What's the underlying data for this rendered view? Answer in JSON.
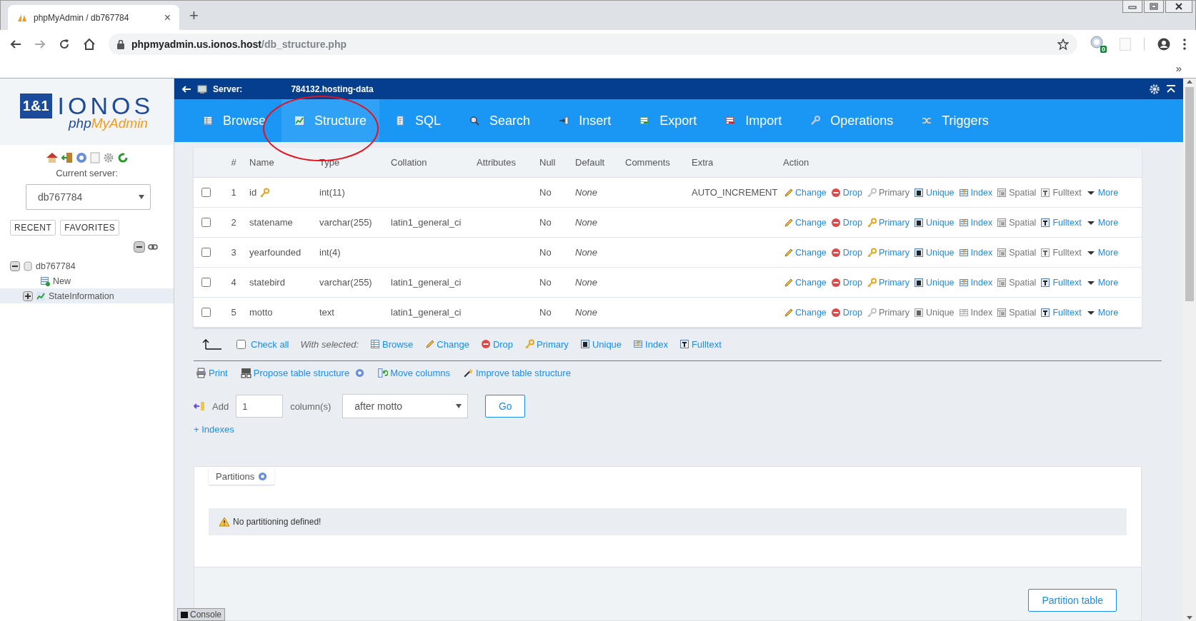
{
  "browser": {
    "tab": {
      "title": "phpMyAdmin / db767784",
      "close": "×"
    },
    "new_tab": "+",
    "url": {
      "host": "phpmyadmin.us.ionos.host",
      "path": "/db_structure.php"
    },
    "extension_badge": "0",
    "bookmarks_overflow": "»"
  },
  "sidebar": {
    "logo": {
      "mark": "1&1",
      "brand": "IONOS",
      "product_prefix": "php",
      "product_name": "MyAdmin"
    },
    "current_server_label": "Current server:",
    "server_select": "db767784",
    "buttons": [
      "RECENT",
      "FAVORITES"
    ],
    "tree": [
      {
        "label": "db767784",
        "kind": "database",
        "expanded": true,
        "selected": false,
        "children": [
          {
            "label": "New",
            "kind": "new",
            "selected": false
          },
          {
            "label": "StateInformation",
            "kind": "table",
            "expanded": false,
            "selected": true
          }
        ]
      }
    ]
  },
  "server_bar": {
    "label": "Server:",
    "value": "784132.hosting-data"
  },
  "menu": [
    {
      "label": "Browse",
      "kind": "browse",
      "selected": false
    },
    {
      "label": "Structure",
      "kind": "structure",
      "selected": true
    },
    {
      "label": "SQL",
      "kind": "sql",
      "selected": false
    },
    {
      "label": "Search",
      "kind": "search",
      "selected": false
    },
    {
      "label": "Insert",
      "kind": "insert",
      "selected": false
    },
    {
      "label": "Export",
      "kind": "export",
      "selected": false
    },
    {
      "label": "Import",
      "kind": "import",
      "selected": false
    },
    {
      "label": "Operations",
      "kind": "operations",
      "selected": false
    },
    {
      "label": "Triggers",
      "kind": "triggers",
      "selected": false
    }
  ],
  "table": {
    "columns": [
      "#",
      "Name",
      "Type",
      "Collation",
      "Attributes",
      "Null",
      "Default",
      "Comments",
      "Extra",
      "Action"
    ],
    "rows": [
      {
        "checked": false,
        "num": "1",
        "name": "id",
        "primary_key": true,
        "type": "int(11)",
        "collation": "",
        "null": "No",
        "default": "None",
        "extra": "AUTO_INCREMENT",
        "actions": [
          {
            "kind": "change",
            "label": "Change",
            "disabled": false
          },
          {
            "kind": "drop",
            "label": "Drop",
            "disabled": false
          },
          {
            "kind": "primary",
            "label": "Primary",
            "disabled": true
          },
          {
            "kind": "unique",
            "label": "Unique",
            "disabled": false
          },
          {
            "kind": "index",
            "label": "Index",
            "disabled": false
          },
          {
            "kind": "spatial",
            "label": "Spatial",
            "disabled": true
          },
          {
            "kind": "fulltext",
            "label": "Fulltext",
            "disabled": true
          },
          {
            "kind": "more",
            "label": "More",
            "disabled": false
          }
        ]
      },
      {
        "checked": false,
        "num": "2",
        "name": "statename",
        "primary_key": false,
        "type": "varchar(255)",
        "collation": "latin1_general_ci",
        "null": "No",
        "default": "None",
        "extra": "",
        "actions": [
          {
            "kind": "change",
            "label": "Change",
            "disabled": false
          },
          {
            "kind": "drop",
            "label": "Drop",
            "disabled": false
          },
          {
            "kind": "primary",
            "label": "Primary",
            "disabled": false
          },
          {
            "kind": "unique",
            "label": "Unique",
            "disabled": false
          },
          {
            "kind": "index",
            "label": "Index",
            "disabled": false
          },
          {
            "kind": "spatial",
            "label": "Spatial",
            "disabled": true
          },
          {
            "kind": "fulltext",
            "label": "Fulltext",
            "disabled": false
          },
          {
            "kind": "more",
            "label": "More",
            "disabled": false
          }
        ]
      },
      {
        "checked": false,
        "num": "3",
        "name": "yearfounded",
        "primary_key": false,
        "type": "int(4)",
        "collation": "",
        "null": "No",
        "default": "None",
        "extra": "",
        "actions": [
          {
            "kind": "change",
            "label": "Change",
            "disabled": false
          },
          {
            "kind": "drop",
            "label": "Drop",
            "disabled": false
          },
          {
            "kind": "primary",
            "label": "Primary",
            "disabled": false
          },
          {
            "kind": "unique",
            "label": "Unique",
            "disabled": false
          },
          {
            "kind": "index",
            "label": "Index",
            "disabled": false
          },
          {
            "kind": "spatial",
            "label": "Spatial",
            "disabled": true
          },
          {
            "kind": "fulltext",
            "label": "Fulltext",
            "disabled": true
          },
          {
            "kind": "more",
            "label": "More",
            "disabled": false
          }
        ]
      },
      {
        "checked": false,
        "num": "4",
        "name": "statebird",
        "primary_key": false,
        "type": "varchar(255)",
        "collation": "latin1_general_ci",
        "null": "No",
        "default": "None",
        "extra": "",
        "actions": [
          {
            "kind": "change",
            "label": "Change",
            "disabled": false
          },
          {
            "kind": "drop",
            "label": "Drop",
            "disabled": false
          },
          {
            "kind": "primary",
            "label": "Primary",
            "disabled": false
          },
          {
            "kind": "unique",
            "label": "Unique",
            "disabled": false
          },
          {
            "kind": "index",
            "label": "Index",
            "disabled": false
          },
          {
            "kind": "spatial",
            "label": "Spatial",
            "disabled": true
          },
          {
            "kind": "fulltext",
            "label": "Fulltext",
            "disabled": false
          },
          {
            "kind": "more",
            "label": "More",
            "disabled": false
          }
        ]
      },
      {
        "checked": false,
        "num": "5",
        "name": "motto",
        "primary_key": false,
        "type": "text",
        "collation": "latin1_general_ci",
        "null": "No",
        "default": "None",
        "extra": "",
        "actions": [
          {
            "kind": "change",
            "label": "Change",
            "disabled": false
          },
          {
            "kind": "drop",
            "label": "Drop",
            "disabled": false
          },
          {
            "kind": "primary",
            "label": "Primary",
            "disabled": true
          },
          {
            "kind": "unique",
            "label": "Unique",
            "disabled": true
          },
          {
            "kind": "index",
            "label": "Index",
            "disabled": true
          },
          {
            "kind": "spatial",
            "label": "Spatial",
            "disabled": true
          },
          {
            "kind": "fulltext",
            "label": "Fulltext",
            "disabled": false
          },
          {
            "kind": "more",
            "label": "More",
            "disabled": false
          }
        ]
      }
    ]
  },
  "bulk": {
    "check_all": {
      "label": "Check all",
      "checked": false
    },
    "with_selected": "With selected:",
    "actions": [
      {
        "kind": "browse",
        "label": "Browse"
      },
      {
        "kind": "change",
        "label": "Change"
      },
      {
        "kind": "drop",
        "label": "Drop"
      },
      {
        "kind": "primary",
        "label": "Primary"
      },
      {
        "kind": "unique",
        "label": "Unique"
      },
      {
        "kind": "index",
        "label": "Index"
      },
      {
        "kind": "fulltext",
        "label": "Fulltext"
      }
    ]
  },
  "tools": [
    {
      "kind": "print",
      "label": "Print",
      "help": false
    },
    {
      "kind": "propose",
      "label": "Propose table structure",
      "help": true
    },
    {
      "kind": "move",
      "label": "Move columns",
      "help": false
    },
    {
      "kind": "improve",
      "label": "Improve table structure",
      "help": false
    }
  ],
  "add_columns": {
    "label": "Add",
    "count": "1",
    "unit": "column(s)",
    "position": "after motto",
    "go": "Go"
  },
  "indexes_link": "+ Indexes",
  "partitions": {
    "legend": "Partitions",
    "notice": "No partitioning defined!",
    "button": "Partition table"
  },
  "console": "Console"
}
